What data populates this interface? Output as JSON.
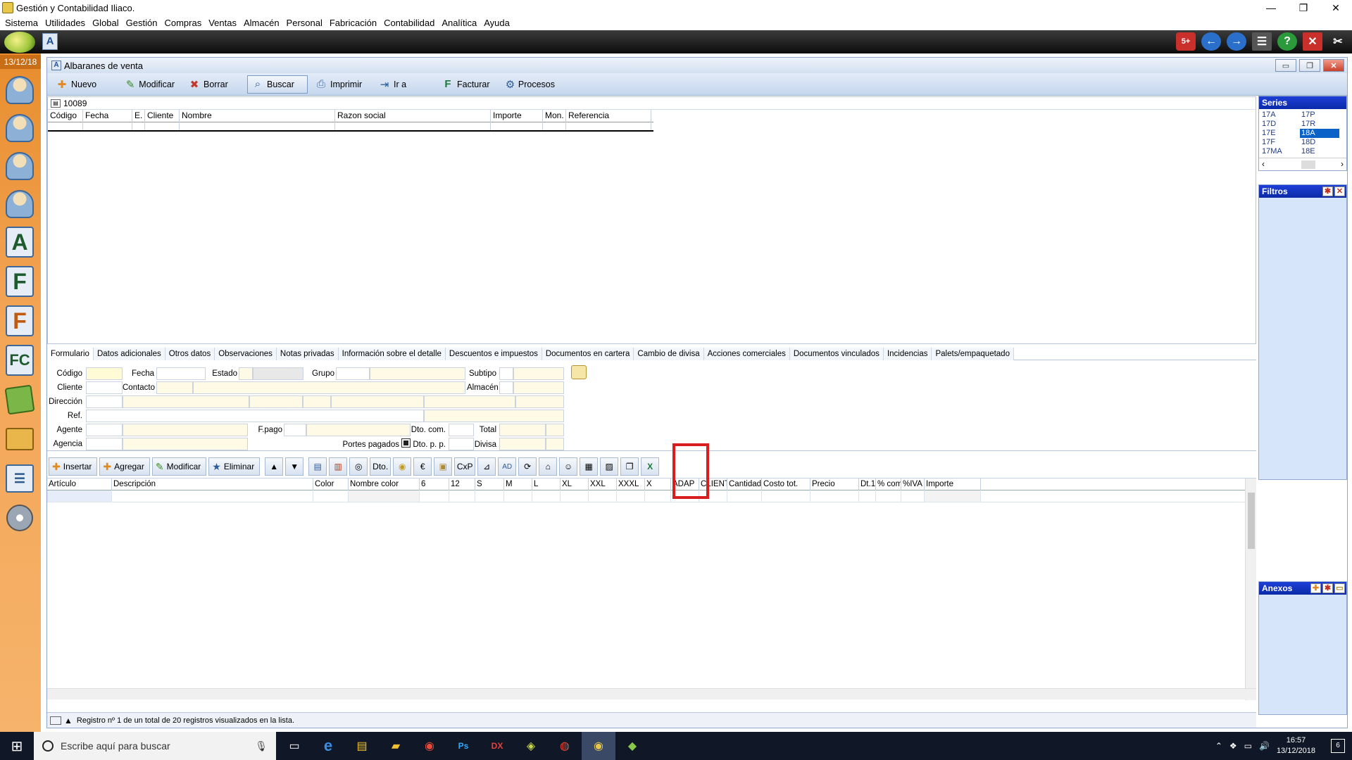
{
  "titlebar": {
    "title": "Gestión y Contabilidad Iliaco.",
    "minimize": "—",
    "maximize": "❐",
    "close": "✕"
  },
  "menu": [
    "Sistema",
    "Utilidades",
    "Global",
    "Gestión",
    "Compras",
    "Ventas",
    "Almacén",
    "Personal",
    "Fabricación",
    "Contabilidad",
    "Analítica",
    "Ayuda"
  ],
  "leftrail": {
    "date": "13/12/18"
  },
  "window": {
    "title": "Albaranes de venta",
    "toolbar": [
      {
        "label": "Nuevo",
        "icon": "new-icon"
      },
      {
        "label": "Modificar",
        "icon": "edit-icon"
      },
      {
        "label": "Borrar",
        "icon": "delete-icon"
      },
      {
        "label": "Buscar",
        "icon": "search-icon"
      },
      {
        "label": "Imprimir",
        "icon": "print-icon"
      },
      {
        "label": "Ir a",
        "icon": "goto-icon"
      },
      {
        "label": "Facturar",
        "icon": "invoice-icon"
      },
      {
        "label": "Procesos",
        "icon": "process-icon"
      }
    ],
    "search_value": "10089",
    "grid_columns": [
      "Código",
      "Fecha",
      "E.",
      "Cliente",
      "Nombre",
      "Razon social",
      "Importe",
      "Mon.",
      "Referencia"
    ]
  },
  "series": {
    "title": "Series",
    "items": [
      "17A",
      "17P",
      "17D",
      "17R",
      "17E",
      "18A",
      "17F",
      "18D",
      "17MA",
      "18E"
    ],
    "selected": "18A"
  },
  "filtros": {
    "title": "Filtros"
  },
  "anexos": {
    "title": "Anexos"
  },
  "tabs": [
    "Formulario",
    "Datos adicionales",
    "Otros datos",
    "Observaciones",
    "Notas privadas",
    "Información sobre el detalle",
    "Descuentos e impuestos",
    "Documentos en cartera",
    "Cambio de divisa",
    "Acciones comerciales",
    "Documentos vinculados",
    "Incidencias",
    "Palets/empaquetado"
  ],
  "form": {
    "codigo": "Código",
    "fecha": "Fecha",
    "estado": "Estado",
    "grupo": "Grupo",
    "subtipo": "Subtipo",
    "cliente": "Cliente",
    "contacto": "Contacto",
    "almacen": "Almacén",
    "direccion": "Dirección",
    "ref": "Ref.",
    "agente": "Agente",
    "fpago": "F.pago",
    "dto_com": "Dto. com.",
    "total": "Total",
    "agencia": "Agencia",
    "portes": "Portes pagados",
    "dto_pp": "Dto. p. p.",
    "divisa": "Divisa"
  },
  "detail_toolbar": {
    "insertar": "Insertar",
    "agregar": "Agregar",
    "modificar": "Modificar",
    "eliminar": "Eliminar",
    "dto": "Dto.",
    "cxp": "CxP"
  },
  "detail_columns": [
    "Artículo",
    "Descripción",
    "Color",
    "Nombre color",
    "6",
    "12",
    "S",
    "M",
    "L",
    "XL",
    "XXL",
    "XXXL",
    "X",
    "ADAP",
    "CLIENT",
    "Cantidad",
    "Costo tot.",
    "Precio",
    "Dt.1",
    "% com.",
    "%IVA",
    "Importe"
  ],
  "status": {
    "text": "Registro nº 1 de un total de 20 registros visualizados en la lista."
  },
  "taskbar": {
    "search_placeholder": "Escribe aquí para buscar",
    "time": "16:57",
    "date": "13/12/2018",
    "notifications": "6"
  }
}
